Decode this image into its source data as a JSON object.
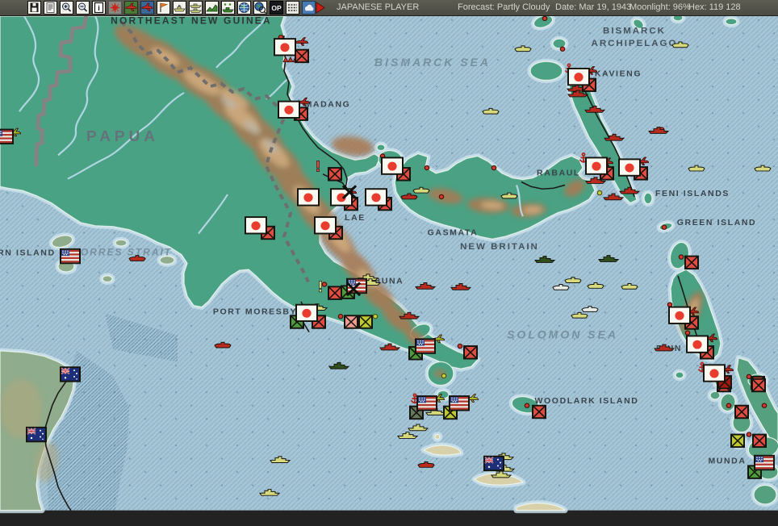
{
  "title_bar": {
    "player": "JAPANESE PLAYER",
    "forecast": "Forecast: Partly Cloudy",
    "date": "Date: Mar 19, 1943",
    "moonlight": "Moonlight: 96%",
    "hex": "Hex: 119 128"
  },
  "toolbar": {
    "icons": [
      "save",
      "document",
      "zoom-in",
      "zoom-out",
      "info",
      "japan-sun",
      "plane-green",
      "plane-blue",
      "flag",
      "ship",
      "task-force",
      "land-move",
      "amphibious",
      "globe",
      "globe-zoom",
      "op-mode",
      "ruler",
      "weather"
    ],
    "play_label": "next-turn"
  },
  "map": {
    "palette": {
      "red": "#bb2a1e",
      "yellow": "#d6da7c",
      "green": "#30501e",
      "white": "#e8eae4",
      "ygreen": "#a9bd2f",
      "xred": "#e04b42",
      "xpink": "#f09a92",
      "xgreen": "#4e9b3e",
      "xygreen": "#bdca30",
      "xdark": "#68785f",
      "xdarkred": "#a8170e",
      "accent_ocean": "#a6c6d7",
      "accent_land": "#49a284"
    },
    "labels": [
      [
        "NORTHEAST NEW GUINEA",
        237,
        30,
        "dark"
      ],
      [
        "BISMARCK SEA",
        536,
        84,
        "sea"
      ],
      [
        "BISMARCK",
        786,
        42,
        "region"
      ],
      [
        "ARCHIPELAGO",
        786,
        58,
        "region"
      ],
      [
        "KAVIENG",
        766,
        97,
        "place"
      ],
      [
        "MADANG",
        406,
        136,
        "place"
      ],
      [
        "RABAUL",
        692,
        224,
        "place"
      ],
      [
        "FENI ISLANDS",
        858,
        250,
        "place"
      ],
      [
        "GREEN ISLAND",
        888,
        287,
        "place"
      ],
      [
        "LAE",
        440,
        281,
        "place"
      ],
      [
        "GASMATA",
        561,
        300,
        "place"
      ],
      [
        "NEW BRITAIN",
        619,
        318,
        "region"
      ],
      [
        "PAPUA",
        152,
        180,
        "big"
      ],
      [
        "TORRES STRAIT",
        152,
        326,
        "seasm"
      ],
      [
        "ORN ISLAND",
        28,
        326,
        "place"
      ],
      [
        "BUNA",
        482,
        362,
        "place"
      ],
      [
        "PORT MORESBY",
        316,
        401,
        "place"
      ],
      [
        "SOLOMON SEA",
        697,
        432,
        "sea"
      ],
      [
        "WOODLARK ISLAND",
        727,
        515,
        "place"
      ],
      [
        "MUNDA",
        901,
        592,
        "place"
      ],
      [
        "BUIN",
        829,
        448,
        "place"
      ]
    ],
    "markers": [
      [
        "dr",
        348,
        47
      ],
      [
        "dr",
        675,
        23
      ],
      [
        "dr",
        697,
        62
      ],
      [
        "dr",
        820,
        165
      ],
      [
        "dr",
        474,
        199
      ],
      [
        "dr",
        529,
        214
      ],
      [
        "dr",
        612,
        214
      ],
      [
        "dr",
        547,
        251
      ],
      [
        "dr",
        402,
        363
      ],
      [
        "dr",
        422,
        404
      ],
      [
        "dr",
        570,
        442
      ],
      [
        "dr",
        653,
        518
      ],
      [
        "dr",
        823,
        290
      ],
      [
        "dr",
        830,
        389
      ],
      [
        "dr",
        844,
        328
      ],
      [
        "dr",
        852,
        425
      ],
      [
        "dr",
        903,
        518
      ],
      [
        "dr",
        947,
        518
      ],
      [
        "dr",
        928,
        481
      ],
      [
        "dr",
        928,
        555
      ],
      [
        "dy",
        743,
        246
      ],
      [
        "dy",
        465,
        404
      ],
      [
        "dy",
        550,
        480
      ],
      [
        "sb",
        170,
        330,
        "red"
      ],
      [
        "sb",
        276,
        441,
        "red"
      ],
      [
        "sb",
        528,
        594,
        "red"
      ],
      [
        "sb",
        507,
        251,
        "red"
      ],
      [
        "sb",
        648,
        62,
        "yellow"
      ],
      [
        "sb",
        843,
        57,
        "yellow"
      ],
      [
        "sb",
        608,
        142,
        "yellow"
      ],
      [
        "sb",
        522,
        243,
        "yellow"
      ],
      [
        "sb",
        631,
        250,
        "yellow"
      ],
      [
        "sb",
        863,
        215,
        "yellow"
      ],
      [
        "sb",
        945,
        215,
        "yellow"
      ],
      [
        "sb",
        710,
        358,
        "yellow"
      ],
      [
        "sb",
        738,
        365,
        "yellow"
      ],
      [
        "sb",
        780,
        366,
        "yellow"
      ],
      [
        "sb",
        718,
        403,
        "yellow"
      ],
      [
        "sb",
        695,
        367,
        "white"
      ],
      [
        "sb",
        731,
        395,
        "white"
      ],
      [
        "sh",
        715,
        112,
        "red"
      ],
      [
        "sh",
        716,
        119,
        "red"
      ],
      [
        "sh",
        737,
        139,
        "red"
      ],
      [
        "sh",
        761,
        175,
        "red"
      ],
      [
        "sh",
        816,
        166,
        "red"
      ],
      [
        "sh",
        738,
        230,
        "red"
      ],
      [
        "sh",
        780,
        243,
        "red"
      ],
      [
        "sh",
        760,
        251,
        "red"
      ],
      [
        "sh",
        507,
        403,
        "red"
      ],
      [
        "sh",
        483,
        443,
        "red"
      ],
      [
        "sh",
        527,
        365,
        "red"
      ],
      [
        "sh",
        571,
        366,
        "red"
      ],
      [
        "sh",
        823,
        444,
        "red"
      ],
      [
        "sh",
        456,
        354,
        "yellow"
      ],
      [
        "sh",
        459,
        360,
        "yellow"
      ],
      [
        "sh",
        393,
        392,
        "yellow"
      ],
      [
        "sh",
        540,
        526,
        "yellow"
      ],
      [
        "sh",
        518,
        546,
        "yellow"
      ],
      [
        "sh",
        505,
        556,
        "yellow"
      ],
      [
        "sh",
        624,
        583,
        "yellow"
      ],
      [
        "sh",
        625,
        598,
        "yellow"
      ],
      [
        "sh",
        621,
        606,
        "yellow"
      ],
      [
        "sh",
        347,
        587,
        "yellow"
      ],
      [
        "sh",
        334,
        629,
        "yellow"
      ],
      [
        "sh",
        675,
        331,
        "green"
      ],
      [
        "sh",
        754,
        330,
        "green"
      ],
      [
        "sh",
        420,
        467,
        "green"
      ],
      [
        "pl",
        373,
        53,
        "red"
      ],
      [
        "pl",
        375,
        130,
        "red"
      ],
      [
        "pl",
        433,
        245,
        "red"
      ],
      [
        "pl",
        731,
        90,
        "red"
      ],
      [
        "pl",
        751,
        207,
        "red"
      ],
      [
        "pl",
        795,
        206,
        "red"
      ],
      [
        "pl",
        857,
        398,
        "red"
      ],
      [
        "pl",
        880,
        432,
        "red"
      ],
      [
        "pl",
        900,
        472,
        "red"
      ],
      [
        "pl",
        17,
        169,
        "ygreen"
      ],
      [
        "pl",
        542,
        433,
        "ygreen"
      ],
      [
        "pl",
        542,
        509,
        "ygreen"
      ],
      [
        "pl",
        584,
        509,
        "ygreen"
      ],
      [
        "an",
        705,
        88
      ],
      [
        "an",
        723,
        202
      ],
      [
        "an",
        514,
        510
      ],
      [
        "an",
        870,
        470
      ],
      [
        "ft",
        360,
        75
      ],
      [
        "ex",
        394,
        212,
        "xred"
      ],
      [
        "ex",
        397,
        366,
        "yellow"
      ],
      [
        "xb",
        374,
        71,
        "xred"
      ],
      [
        "xb",
        373,
        145,
        "xred"
      ],
      [
        "xb",
        415,
        222,
        "xred"
      ],
      [
        "xb",
        435,
        260,
        "xred"
      ],
      [
        "xb",
        477,
        260,
        "xred"
      ],
      [
        "xb",
        500,
        222,
        "xred"
      ],
      [
        "xb",
        332,
        297,
        "xred"
      ],
      [
        "xb",
        416,
        297,
        "xred"
      ],
      [
        "xb",
        730,
        108,
        "xred"
      ],
      [
        "xb",
        752,
        221,
        "xred"
      ],
      [
        "xb",
        794,
        221,
        "xred"
      ],
      [
        "xb",
        415,
        374,
        "xred"
      ],
      [
        "xb",
        395,
        411,
        "xred"
      ],
      [
        "xb",
        583,
        450,
        "xred"
      ],
      [
        "xb",
        668,
        526,
        "xred"
      ],
      [
        "xb",
        857,
        335,
        "xred"
      ],
      [
        "xb",
        857,
        412,
        "xred"
      ],
      [
        "xb",
        876,
        450,
        "xred"
      ],
      [
        "xb",
        939,
        489,
        "xred"
      ],
      [
        "xb",
        897,
        492,
        "xred"
      ],
      [
        "xb",
        940,
        492,
        "xred"
      ],
      [
        "xb",
        919,
        526,
        "xred"
      ],
      [
        "xb",
        941,
        563,
        "xred"
      ],
      [
        "xb",
        898,
        488,
        "xdarkred"
      ],
      [
        "xb",
        431,
        373,
        "xgreen"
      ],
      [
        "xb",
        368,
        411,
        "xgreen"
      ],
      [
        "xb",
        515,
        451,
        "xgreen"
      ],
      [
        "xb",
        935,
        603,
        "xgreen"
      ],
      [
        "xb",
        453,
        411,
        "xygreen"
      ],
      [
        "xb",
        558,
        527,
        "xygreen"
      ],
      [
        "xb",
        914,
        563,
        "xygreen"
      ],
      [
        "xb",
        435,
        411,
        "xpink"
      ],
      [
        "xb",
        516,
        527,
        "xdark"
      ],
      [
        "fj",
        353,
        60
      ],
      [
        "fj",
        358,
        140
      ],
      [
        "fj",
        382,
        252
      ],
      [
        "fj",
        423,
        252
      ],
      [
        "fj",
        466,
        252
      ],
      [
        "fj",
        486,
        212
      ],
      [
        "fj",
        317,
        288
      ],
      [
        "fj",
        403,
        288
      ],
      [
        "fj",
        380,
        400
      ],
      [
        "fj",
        717,
        98
      ],
      [
        "fj",
        739,
        212
      ],
      [
        "fj",
        780,
        214
      ],
      [
        "fj",
        842,
        403
      ],
      [
        "fj",
        864,
        440
      ],
      [
        "fj",
        885,
        477
      ],
      [
        "fu",
        4,
        174
      ],
      [
        "fu",
        87,
        327
      ],
      [
        "fu",
        442,
        365
      ],
      [
        "fu",
        527,
        442
      ],
      [
        "fu",
        529,
        515
      ],
      [
        "fu",
        569,
        515
      ],
      [
        "fu",
        947,
        591
      ],
      [
        "fa",
        87,
        478
      ],
      [
        "fa",
        45,
        555
      ],
      [
        "fa",
        612,
        592
      ],
      [
        "bx",
        438,
        369
      ],
      [
        "bx",
        433,
        245
      ]
    ]
  }
}
